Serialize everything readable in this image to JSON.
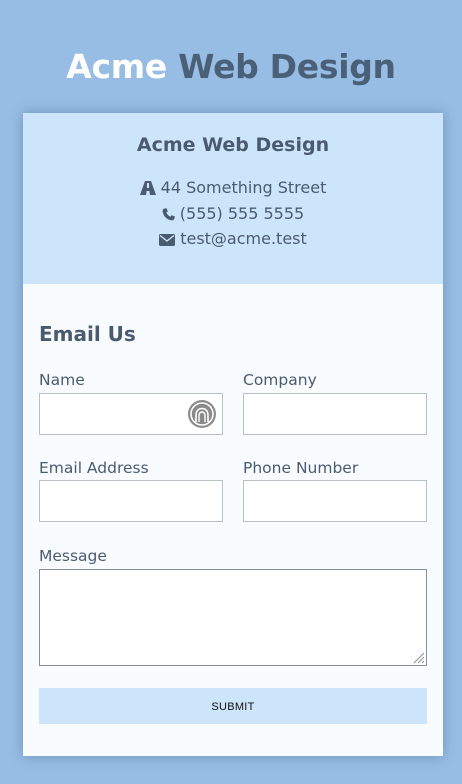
{
  "header": {
    "brand_part1": "Acme",
    "brand_part2": "Web Design"
  },
  "contact": {
    "title": "Acme Web Design",
    "address": "44 Something Street",
    "phone": "(555) 555 5555",
    "email": "test@acme.test",
    "icons": [
      "road-icon",
      "phone-icon",
      "envelope-icon"
    ]
  },
  "form": {
    "title": "Email Us",
    "name_label": "Name",
    "name_value": "",
    "company_label": "Company",
    "company_value": "",
    "email_label": "Email Address",
    "email_value": "",
    "phone_label": "Phone Number",
    "phone_value": "",
    "message_label": "Message",
    "message_value": "",
    "submit_label": "SUBMIT"
  },
  "colors": {
    "page_background": "#97bde4",
    "panel_background": "#cde5fa",
    "form_background": "#f8fcff",
    "brand_highlight": "#ffffff",
    "text": "#4a5b70"
  }
}
